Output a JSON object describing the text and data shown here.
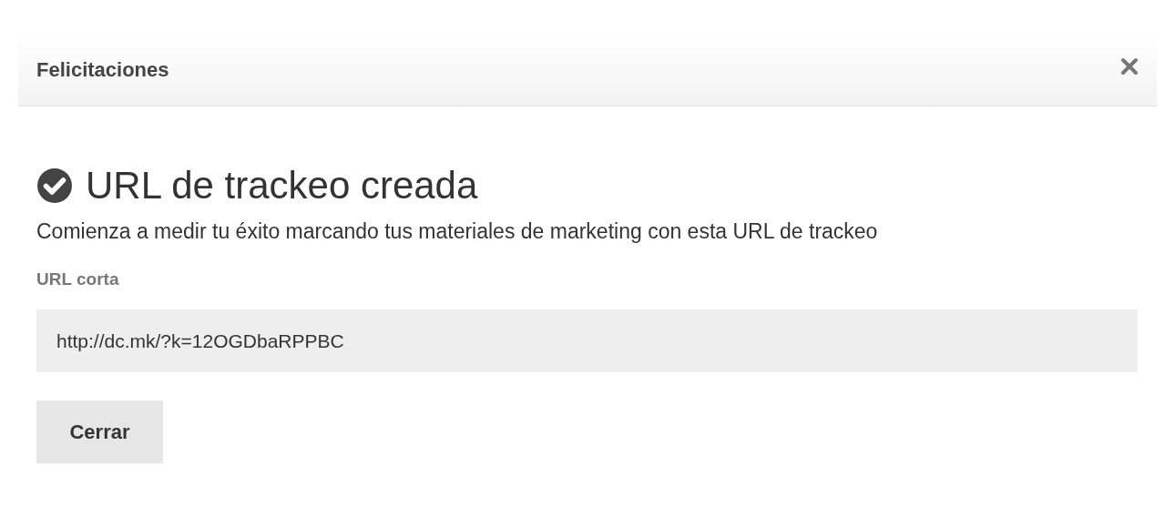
{
  "dialog": {
    "title": "Felicitaciones"
  },
  "heading": "URL de trackeo creada",
  "description": "Comienza a medir tu éxito marcando tus materiales de marketing con esta URL de trackeo",
  "field": {
    "label": "URL corta",
    "value": "http://dc.mk/?k=12OGDbaRPPBC"
  },
  "buttons": [
    "Cerrar"
  ]
}
